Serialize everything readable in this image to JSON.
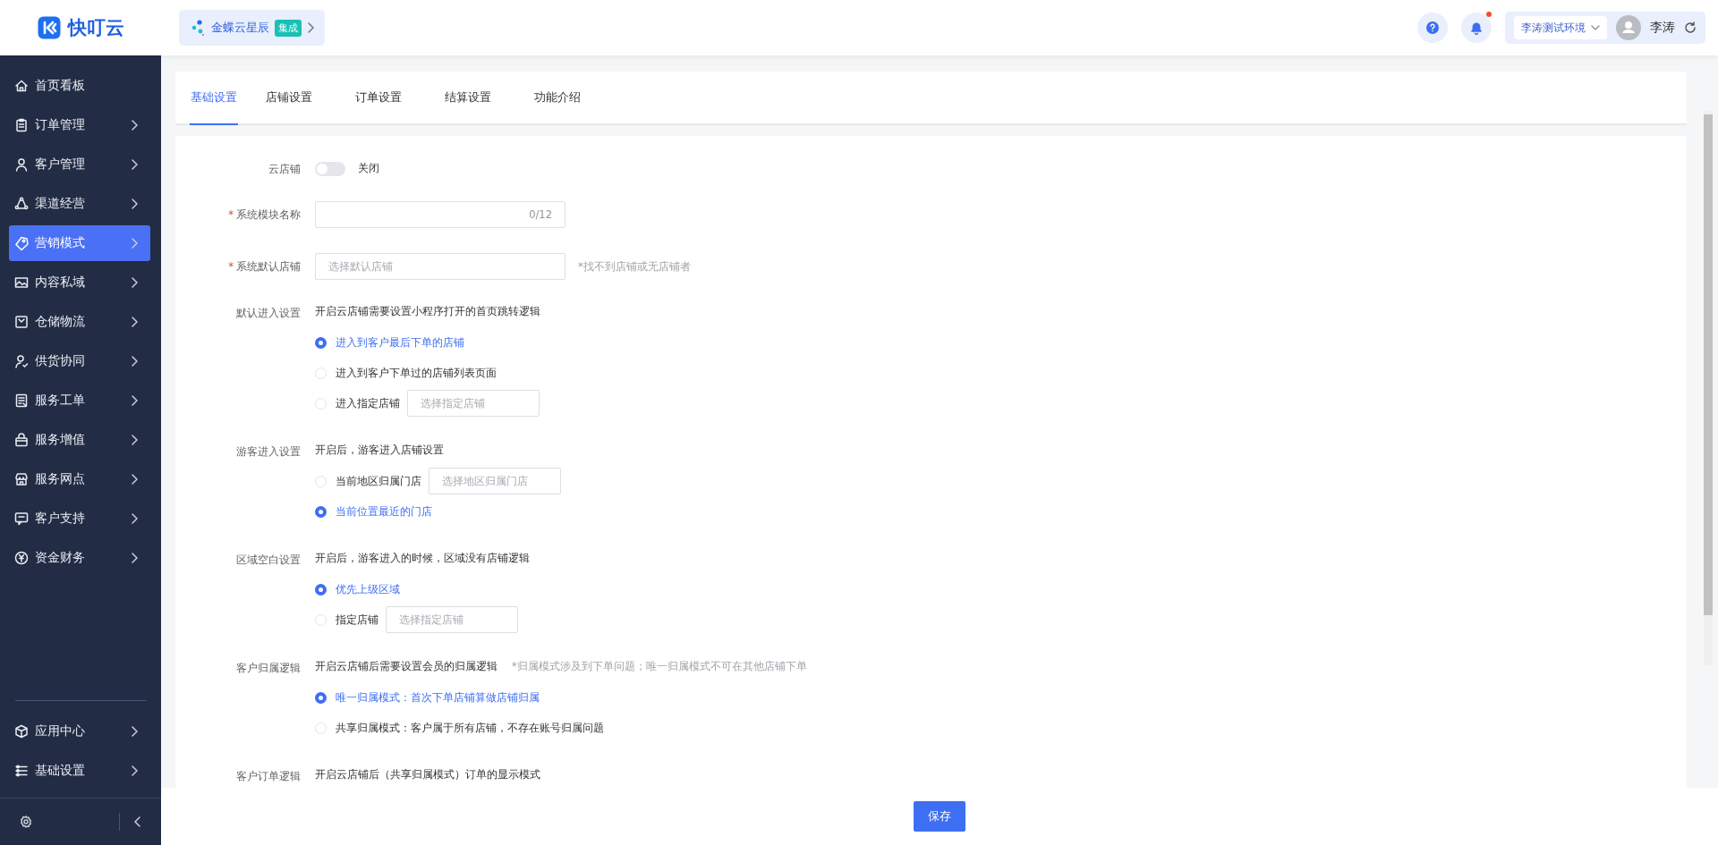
{
  "brand": {
    "name": "快叮云"
  },
  "integration": {
    "label": "金蝶云星辰",
    "badge": "集成"
  },
  "header": {
    "notification_dot": true,
    "environment": "李涛测试环境",
    "user": "李涛"
  },
  "sidebar": {
    "items": [
      {
        "label": "首页看板",
        "selected": false,
        "has_arrow": false
      },
      {
        "label": "订单管理",
        "selected": false,
        "has_arrow": true
      },
      {
        "label": "客户管理",
        "selected": false,
        "has_arrow": true
      },
      {
        "label": "渠道经营",
        "selected": false,
        "has_arrow": true
      },
      {
        "label": "营销模式",
        "selected": true,
        "has_arrow": true
      },
      {
        "label": "内容私域",
        "selected": false,
        "has_arrow": true
      },
      {
        "label": "仓储物流",
        "selected": false,
        "has_arrow": true
      },
      {
        "label": "供货协同",
        "selected": false,
        "has_arrow": true
      },
      {
        "label": "服务工单",
        "selected": false,
        "has_arrow": true
      },
      {
        "label": "服务增值",
        "selected": false,
        "has_arrow": true
      },
      {
        "label": "服务网点",
        "selected": false,
        "has_arrow": true
      },
      {
        "label": "客户支持",
        "selected": false,
        "has_arrow": true
      },
      {
        "label": "资金财务",
        "selected": false,
        "has_arrow": true
      }
    ],
    "bottom_items": [
      {
        "label": "应用中心",
        "selected": false,
        "has_arrow": true
      },
      {
        "label": "基础设置",
        "selected": false,
        "has_arrow": true
      }
    ]
  },
  "tabs": [
    {
      "label": "基础设置",
      "selected": true
    },
    {
      "label": "店铺设置",
      "selected": false
    },
    {
      "label": "订单设置",
      "selected": false
    },
    {
      "label": "结算设置",
      "selected": false
    },
    {
      "label": "功能介绍",
      "selected": false
    }
  ],
  "form": {
    "rows": [
      {
        "kind": "switch",
        "label": "云店铺",
        "on": false,
        "state_text": "关闭"
      },
      {
        "kind": "counter_input",
        "label": "系统模块名称",
        "required_mark": "*",
        "counter": "0/12"
      },
      {
        "kind": "select",
        "label": "系统默认店铺",
        "required_mark": "*",
        "placeholder": "选择默认店铺",
        "hint": "*找不到店铺或无店铺者"
      },
      {
        "kind": "radio_group",
        "label": "默认进入设置",
        "description": "开启云店铺需要设置小程序打开的首页跳转逻辑",
        "options": [
          {
            "label": "进入到客户最后下单的店铺",
            "selected": true
          },
          {
            "label": "进入到客户下单过的店铺列表页面",
            "selected": false
          },
          {
            "label": "进入指定店铺",
            "selected": false,
            "placeholder": "选择指定店铺"
          }
        ]
      },
      {
        "kind": "radio_group",
        "label": "游客进入设置",
        "description": "开启后，游客进入店铺设置",
        "options": [
          {
            "label": "当前地区归属门店",
            "selected": false,
            "placeholder": "选择地区归属门店"
          },
          {
            "label": "当前位置最近的门店",
            "selected": true
          }
        ]
      },
      {
        "kind": "radio_group",
        "label": "区域空白设置",
        "description": "开启后，游客进入的时候，区域没有店铺逻辑",
        "options": [
          {
            "label": "优先上级区域",
            "selected": true
          },
          {
            "label": "指定店铺",
            "selected": false,
            "placeholder": "选择指定店铺"
          }
        ]
      },
      {
        "kind": "radio_group",
        "label": "客户归属逻辑",
        "description": "开启云店铺后需要设置会员的归属逻辑",
        "hint": "*归属模式涉及到下单问题；唯一归属模式不可在其他店铺下单",
        "options": [
          {
            "label": "唯一归属模式：首次下单店铺算做店铺归属",
            "selected": true
          },
          {
            "label": "共享归属模式：客户属于所有店铺，不存在账号归属问题",
            "selected": false
          }
        ]
      },
      {
        "kind": "radio_group",
        "label": "客户订单逻辑",
        "description": "开启云店铺后（共享归属模式）订单的显示模式",
        "options": []
      }
    ]
  },
  "footer": {
    "save": "保存"
  }
}
